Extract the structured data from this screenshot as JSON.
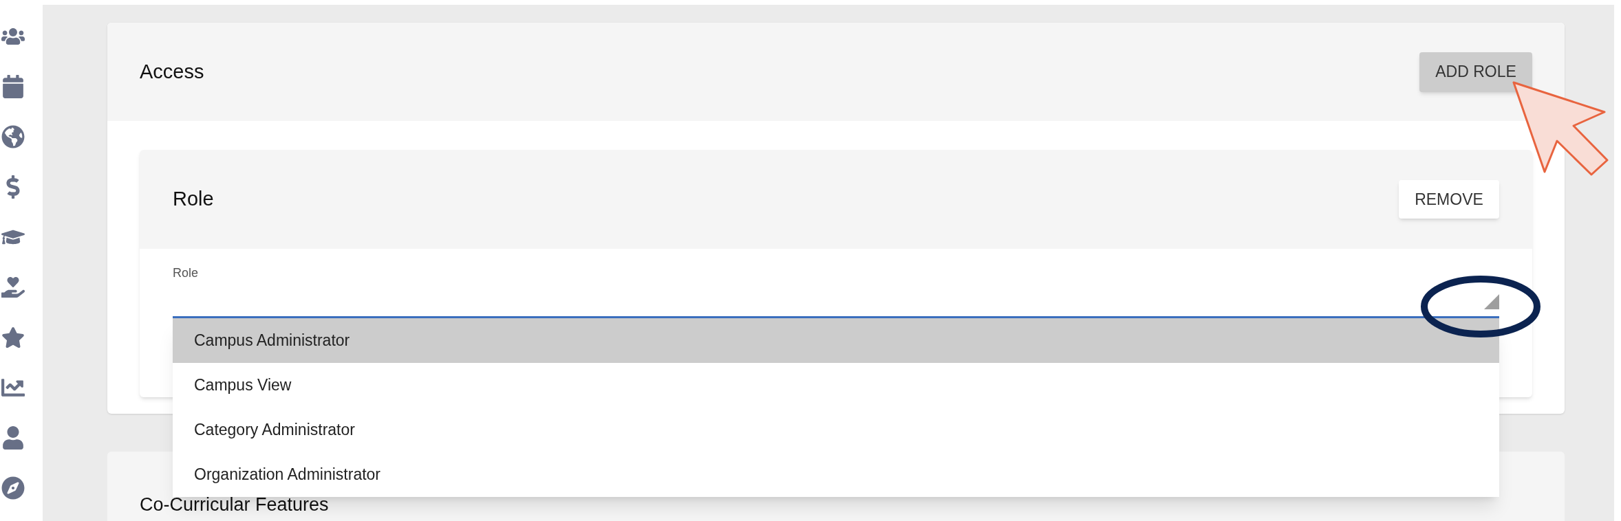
{
  "access": {
    "title": "Access",
    "add_button": "ADD ROLE"
  },
  "role_card": {
    "title": "Role",
    "remove_button": "REMOVE",
    "field": {
      "label": "Role",
      "open": true,
      "options": [
        {
          "label": "Campus Administrator",
          "selected": true
        },
        {
          "label": "Campus View",
          "selected": false
        },
        {
          "label": "Category Administrator",
          "selected": false
        },
        {
          "label": "Organization Administrator",
          "selected": false
        }
      ]
    }
  },
  "next_section": {
    "title": "Co-Curricular Features"
  }
}
